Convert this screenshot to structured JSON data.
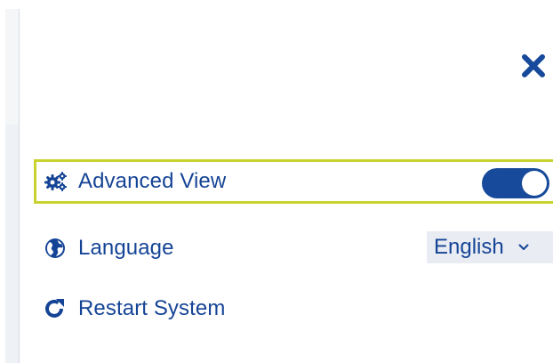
{
  "settings_panel": {
    "close_icon": "close-icon",
    "items": [
      {
        "label": "Advanced View",
        "icon": "cogs-icon",
        "control": "toggle",
        "toggle_on": true
      },
      {
        "label": "Language",
        "icon": "globe-icon",
        "control": "select",
        "selected": "English"
      },
      {
        "label": "Restart System",
        "icon": "redo-icon",
        "control": "none"
      }
    ]
  },
  "colors": {
    "accent": "#184a9b",
    "text": "#154496",
    "highlight_border": "#c8d32f",
    "select_bg": "#e9edf3"
  }
}
